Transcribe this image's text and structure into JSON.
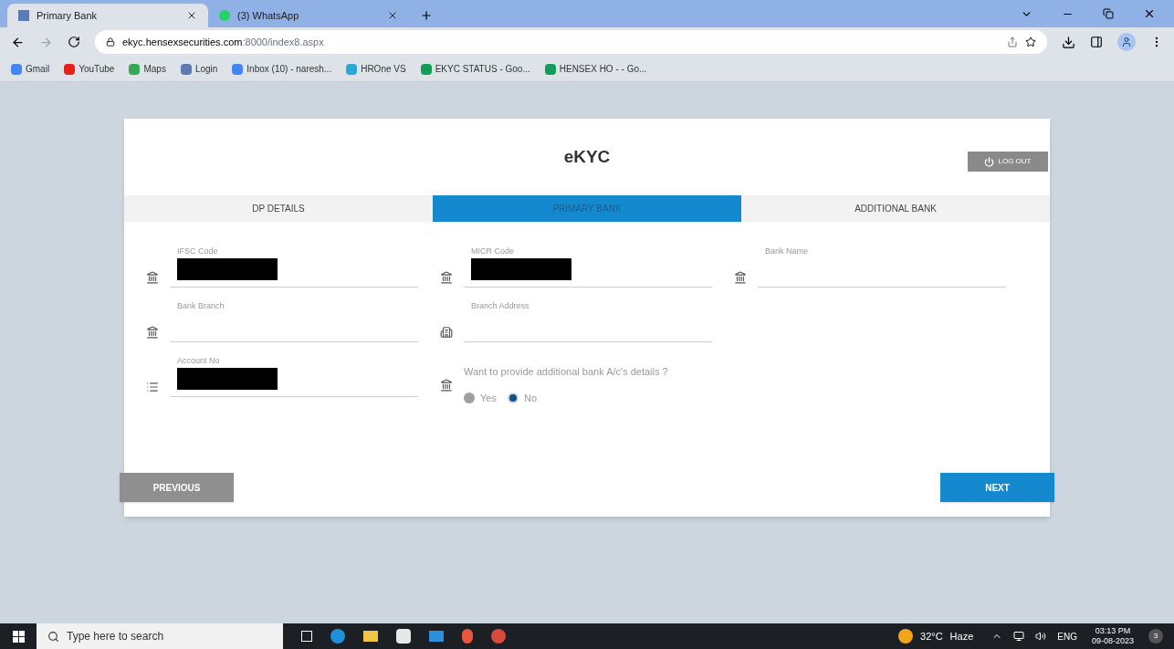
{
  "browser": {
    "tabs": [
      {
        "title": "Primary Bank",
        "selected": true
      },
      {
        "title": "(3) WhatsApp",
        "selected": false
      }
    ],
    "url_host": "ekyc.hensexsecurities.com",
    "url_path": ":8000/index8.aspx",
    "bookmarks": [
      "Gmail",
      "YouTube",
      "Maps",
      "Login",
      "Inbox (10) - naresh...",
      "HROne VS",
      "EKYC STATUS - Goo...",
      "HENSEX HO - - Go..."
    ]
  },
  "page": {
    "title": "eKYC",
    "logout": "LOG OUT",
    "tabs": [
      {
        "label": "DP DETAILS",
        "selected": false
      },
      {
        "label": "PRIMARY BANK",
        "selected": true
      },
      {
        "label": "ADDITIONAL BANK",
        "selected": false
      }
    ],
    "fields": [
      {
        "label": "IFSC Code",
        "redacted": true
      },
      {
        "label": "MICR Code",
        "redacted": true
      },
      {
        "label": "Bank Name",
        "redacted": false
      },
      {
        "label": "Bank Branch",
        "redacted": false
      },
      {
        "label": "Branch Address",
        "redacted": false
      },
      {
        "label": "Account No",
        "redacted": true
      }
    ],
    "question": "Want to provide additional bank A/c's details ?",
    "options": [
      {
        "label": "Yes",
        "selected": false
      },
      {
        "label": "No",
        "selected": true
      }
    ],
    "previous": "PREVIOUS",
    "next": "NEXT"
  },
  "taskbar": {
    "search_placeholder": "Type here to search",
    "temperature": "32°C",
    "weather": "Haze",
    "language": "ENG",
    "time": "03:13 PM",
    "date": "09-08-2023",
    "notifications": "3"
  }
}
